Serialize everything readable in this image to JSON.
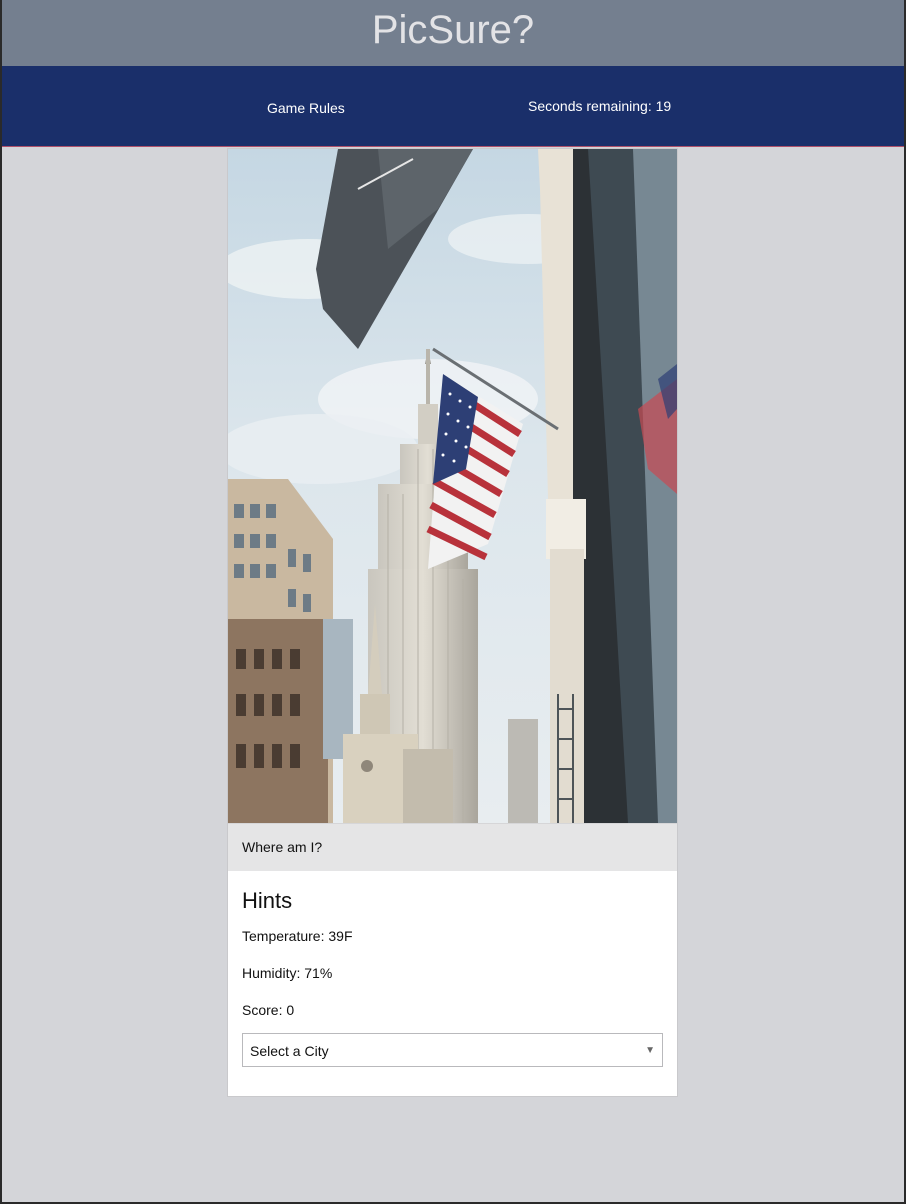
{
  "header": {
    "title": "PicSure?"
  },
  "nav": {
    "rules_label": "Game Rules",
    "timer_label": "Seconds remaining:",
    "seconds_remaining": 19
  },
  "photo": {
    "icon": "city-street-photo"
  },
  "question": {
    "label": "Where am I?"
  },
  "hints": {
    "title": "Hints",
    "temperature_label": "Temperature:",
    "temperature_value": "39F",
    "humidity_label": "Humidity:",
    "humidity_value": "71%",
    "score_label": "Score:",
    "score_value": 0
  },
  "city_select": {
    "selected": "Select a City",
    "arrow_icon": "chevron-down-icon"
  },
  "colors": {
    "title_bar": "#747f8f",
    "nav_bar": "#1a2f6a",
    "page_bg": "#d4d5d9",
    "card_bg": "#ffffff",
    "caption_bg": "#e5e5e6"
  }
}
